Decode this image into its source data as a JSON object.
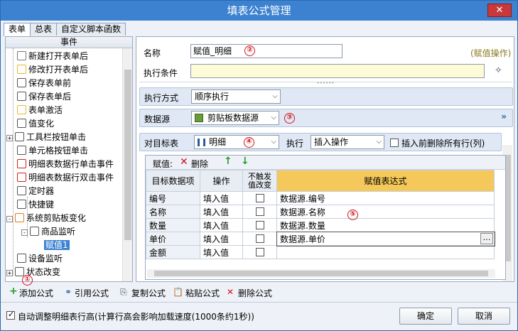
{
  "window": {
    "title": "填表公式管理",
    "close": "✕"
  },
  "tabs": [
    "表单",
    "总表",
    "自定义脚本函数"
  ],
  "left": {
    "header": "事件",
    "items": [
      {
        "label": "新建打开表单后",
        "icon": "user-icon",
        "color": "#777"
      },
      {
        "label": "修改打开表单后",
        "icon": "folder-icon",
        "color": "#e8b830"
      },
      {
        "label": "保存表单前",
        "icon": "save-icon",
        "color": "#555"
      },
      {
        "label": "保存表单后",
        "icon": "save-icon",
        "color": "#555"
      },
      {
        "label": "表单激活",
        "icon": "folder-icon",
        "color": "#e8b830"
      },
      {
        "label": "值变化",
        "icon": "document-icon",
        "color": "#555"
      },
      {
        "label": "工具栏按钮单击",
        "icon": "search-icon",
        "color": "#555"
      },
      {
        "label": "单元格按钮单击",
        "icon": "dash-icon",
        "color": "#555"
      },
      {
        "label": "明细表数据行单击事件",
        "icon": "flag-icon",
        "color": "#d02020"
      },
      {
        "label": "明细表数据行双击事件",
        "icon": "flag-icon",
        "color": "#d02020"
      },
      {
        "label": "定时器",
        "icon": "timer-icon",
        "color": "#555"
      },
      {
        "label": "快捷键",
        "icon": "keyboard-icon",
        "color": "#555"
      },
      {
        "label": "系统剪贴板变化",
        "icon": "scissors-icon",
        "color": "#e08020"
      },
      {
        "label": "商品监听",
        "icon": "document-icon",
        "color": "#555"
      },
      {
        "label": "赋值1",
        "icon": "",
        "color": ""
      },
      {
        "label": "设备监听",
        "icon": "device-icon",
        "color": "#555"
      },
      {
        "label": "状态改变",
        "icon": "status-icon",
        "color": "#555"
      }
    ]
  },
  "form": {
    "name_label": "名称",
    "name_value": "赋值_明细",
    "type_hint": "(赋值操作)",
    "cond_label": "执行条件",
    "mode_label": "执行方式",
    "mode_value": "顺序执行",
    "source_label": "数据源",
    "source_value": "剪贴板数据源",
    "target_label": "对目标表",
    "target_value": "明细",
    "exec_label": "执行",
    "exec_value": "插入操作",
    "clear_label": "插入前删除所有行(列)"
  },
  "grid": {
    "toolbar_label": "赋值:",
    "delete_label": "删除",
    "headers": [
      "目标数据项",
      "操作",
      "不触发值改变",
      "赋值表达式"
    ],
    "rows": [
      {
        "target": "编号",
        "op": "填入值",
        "expr": "数据源.编号"
      },
      {
        "target": "名称",
        "op": "填入值",
        "expr": "数据源.名称"
      },
      {
        "target": "数量",
        "op": "填入值",
        "expr": "数据源.数量"
      },
      {
        "target": "单价",
        "op": "填入值",
        "expr": "数据源.单价"
      },
      {
        "target": "金额",
        "op": "填入值",
        "expr": ""
      }
    ]
  },
  "bottom": {
    "add": "添加公式",
    "ref": "引用公式",
    "copy": "复制公式",
    "paste": "粘贴公式",
    "delete": "删除公式",
    "auto_label": "自动调整明细表行高(计算行高会影响加载速度(1000条约1秒))",
    "ok": "确定",
    "cancel": "取消"
  },
  "markers": [
    "①",
    "②",
    "③",
    "④",
    "⑤"
  ],
  "colors": {
    "title": "#3c82d0",
    "accent_red": "#d0121b",
    "gold_header": "#f4c85a",
    "hint": "#8a7a20"
  }
}
